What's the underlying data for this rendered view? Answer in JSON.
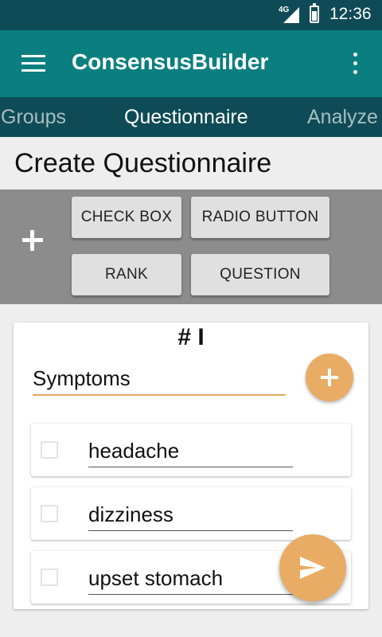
{
  "status_bar": {
    "network": "4G",
    "time": "12:36"
  },
  "app_bar": {
    "title": "ConsensusBuilder"
  },
  "tabs": [
    {
      "label": "Groups",
      "active": false
    },
    {
      "label": "Questionnaire",
      "active": true
    },
    {
      "label": "Analyze",
      "active": false
    }
  ],
  "page": {
    "title": "Create Questionnaire"
  },
  "toolbox": {
    "check_box_label": "CHECK BOX",
    "radio_button_label": "RADIO BUTTON",
    "rank_label": "RANK",
    "question_label": "QUESTION"
  },
  "question": {
    "number": "# I",
    "name": "Symptoms",
    "options": [
      {
        "text": "headache",
        "checked": false
      },
      {
        "text": "dizziness",
        "checked": false
      },
      {
        "text": "upset stomach",
        "checked": false
      }
    ]
  },
  "colors": {
    "status_bar": "#0e4b56",
    "app_bar": "#0b7f80",
    "tab_bar": "#0e4b56",
    "accent": "#e8ac64",
    "toolbox_bg": "#8c8c8c"
  },
  "icons": {
    "menu": "hamburger-menu-icon",
    "overflow": "more-vert-icon",
    "add": "plus-icon",
    "send": "send-icon",
    "signal": "signal-icon",
    "battery": "battery-icon"
  }
}
